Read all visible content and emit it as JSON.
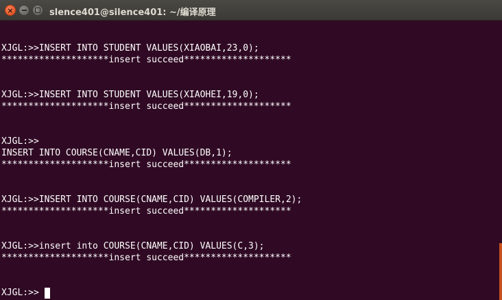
{
  "window": {
    "title": "slence401@silence401: ~/编译原理",
    "close_glyph": "×"
  },
  "terminal": {
    "lines": [
      "XJGL:>>INSERT INTO STUDENT VALUES(XIAOBAI,23,0);",
      "********************insert succeed********************",
      "XJGL:>>INSERT INTO STUDENT VALUES(XIAOHEI,19,0);",
      "********************insert succeed********************",
      "XJGL:>>",
      "INSERT INTO COURSE(CNAME,CID) VALUES(DB,1);",
      "********************insert succeed********************",
      "XJGL:>>INSERT INTO COURSE(CNAME,CID) VALUES(COMPILER,2);",
      "********************insert succeed********************",
      "XJGL:>>insert into COURSE(CNAME,CID) VALUES(C,3);",
      "********************insert succeed********************",
      "XJGL:>>"
    ]
  },
  "colors": {
    "terminal_bg": "#300a24",
    "text": "#ffffff",
    "titlebar": "#3c3b37",
    "close_button": "#e95420",
    "scrollbar": "#c8501e"
  }
}
